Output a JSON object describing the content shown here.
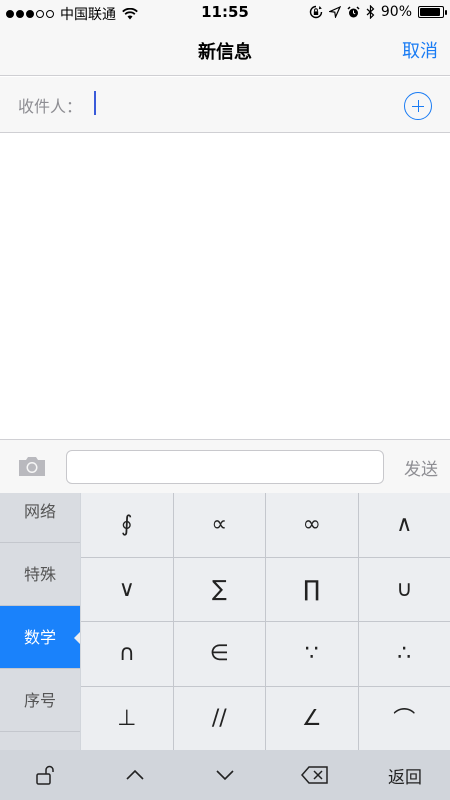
{
  "status_bar": {
    "carrier": "中国联通",
    "time": "11:55",
    "battery_percent": "90%",
    "signal_bars_filled": 3,
    "signal_bars_total": 5,
    "battery_level": 0.9,
    "icons": [
      "signal-icon",
      "wifi-icon",
      "rotation-lock-icon",
      "location-icon",
      "alarm-icon",
      "bluetooth-icon",
      "battery-icon"
    ]
  },
  "nav": {
    "title": "新信息",
    "cancel_label": "取消",
    "accent_color": "#1a7cf4"
  },
  "recipient": {
    "label": "收件人：",
    "value": "",
    "add_icon": "add-contact-icon"
  },
  "compose": {
    "camera_icon": "camera-icon",
    "input_value": "",
    "send_label": "发送"
  },
  "keyboard": {
    "categories": [
      {
        "label": "网络",
        "active": false
      },
      {
        "label": "特殊",
        "active": false
      },
      {
        "label": "数学",
        "active": true
      },
      {
        "label": "序号",
        "active": false
      }
    ],
    "active_color": "#1a82fb",
    "symbols": [
      "∮",
      "∝",
      "∞",
      "∧",
      "∨",
      "∑",
      "∏",
      "∪",
      "∩",
      "∈",
      "∵",
      "∴",
      "⊥",
      "//",
      "∠",
      "⌒"
    ],
    "toolbar": {
      "lock_icon": "unlock-icon",
      "up_icon": "chevron-up-icon",
      "down_icon": "chevron-down-icon",
      "delete_icon": "delete-icon",
      "return_label": "返回"
    }
  }
}
